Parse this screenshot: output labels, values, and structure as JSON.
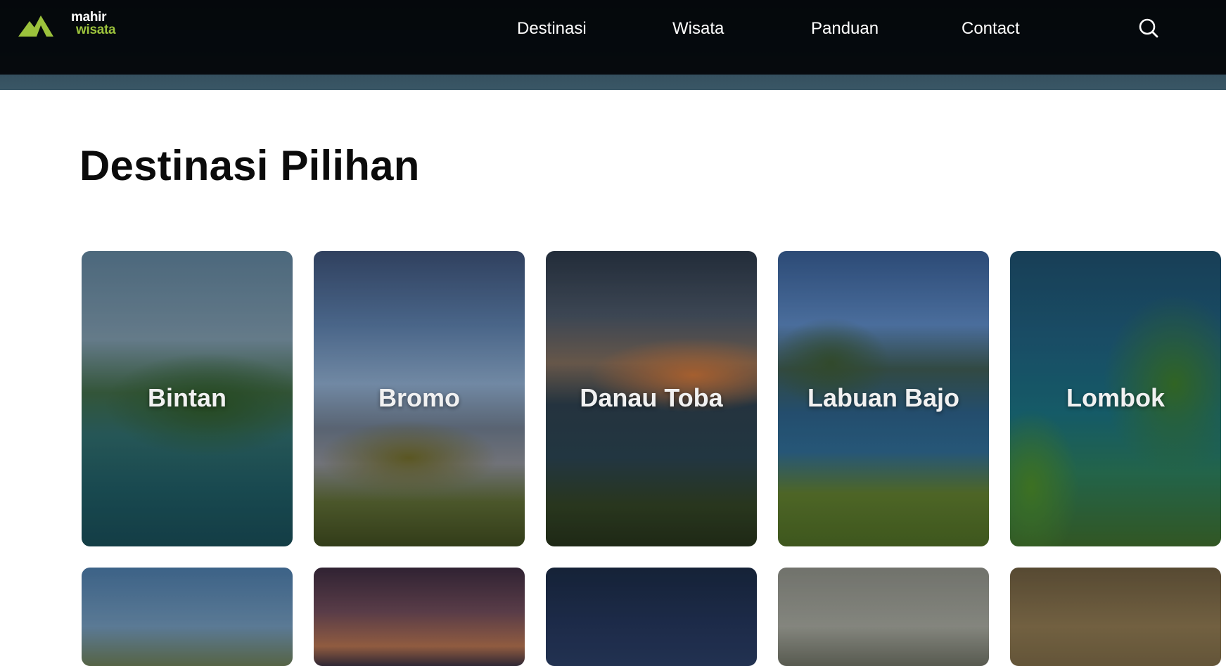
{
  "brand": {
    "line1": "mahir",
    "line2": "wisata",
    "colors": {
      "accent": "#9cc23c",
      "navbar": "#05080b"
    }
  },
  "nav": {
    "items": [
      {
        "label": "Destinasi"
      },
      {
        "label": "Wisata"
      },
      {
        "label": "Panduan"
      },
      {
        "label": "Contact"
      }
    ],
    "search_icon": "search-icon"
  },
  "section": {
    "title": "Destinasi Pilihan",
    "cards": [
      {
        "label": "Bintan"
      },
      {
        "label": "Bromo"
      },
      {
        "label": "Danau Toba"
      },
      {
        "label": "Labuan Bajo"
      },
      {
        "label": "Lombok"
      }
    ],
    "second_row_cards": 5
  }
}
